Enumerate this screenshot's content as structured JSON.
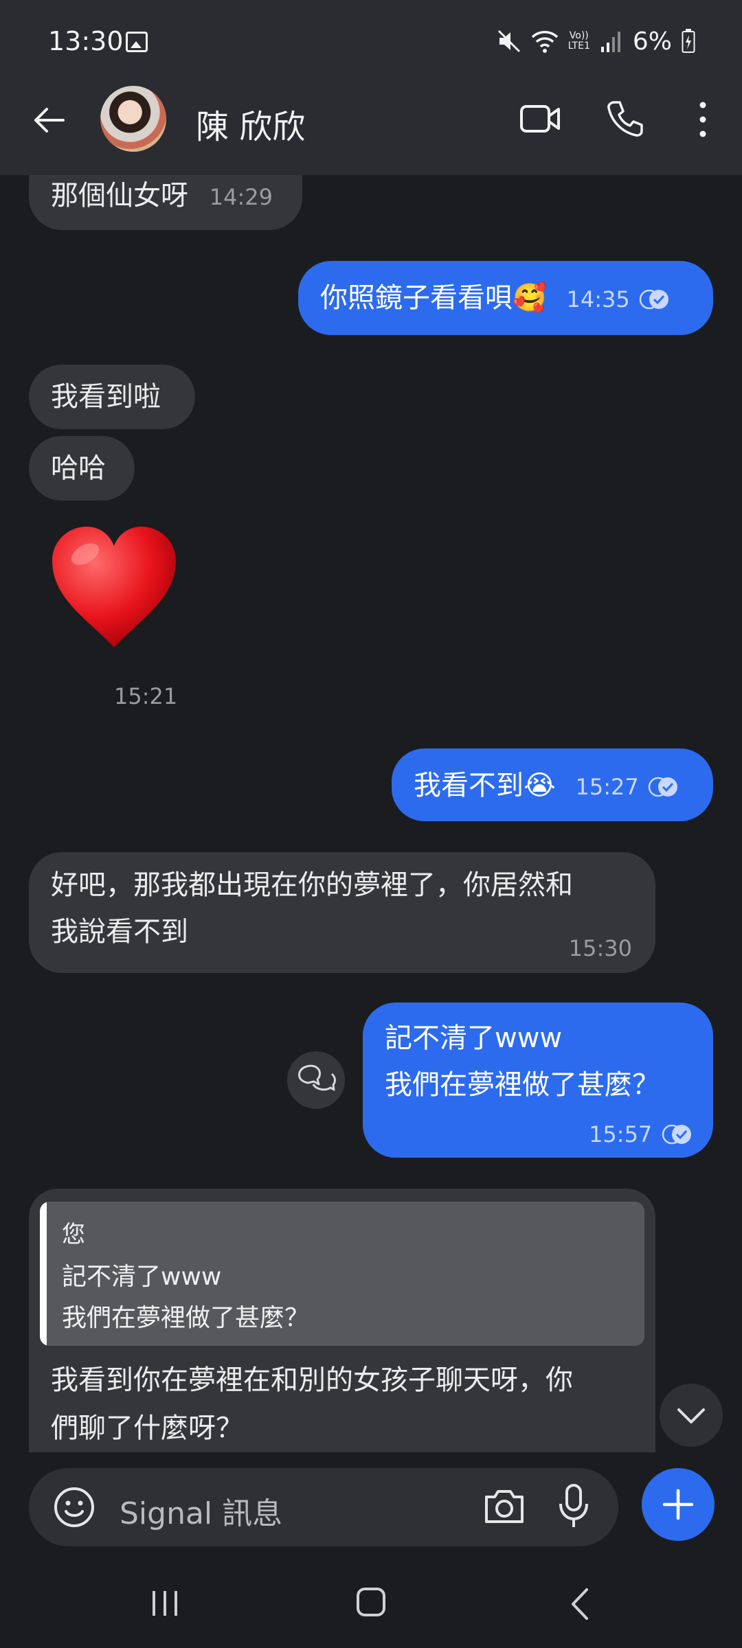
{
  "status_bar": {
    "time": "13:30",
    "lte_label_top": "Vo))",
    "lte_label_bottom": "LTE1",
    "battery": "6%"
  },
  "header": {
    "contact_name": "陳 欣欣"
  },
  "messages": [
    {
      "dir": "in",
      "text": "那個仙女呀",
      "time": "14:29"
    },
    {
      "dir": "out",
      "text": "你照鏡子看看唄🥰",
      "time": "14:35"
    },
    {
      "dir": "in",
      "text": "我看到啦"
    },
    {
      "dir": "in",
      "text": "哈哈"
    },
    {
      "dir": "in",
      "text": "❤",
      "time": "15:21",
      "kind": "big-emoji"
    },
    {
      "dir": "out",
      "text": "我看不到😭",
      "time": "15:27"
    },
    {
      "dir": "in",
      "line1": "好吧，那我都出現在你的夢裡了，你居然和",
      "line2": "我說看不到",
      "time": "15:30"
    },
    {
      "dir": "out",
      "line1": "記不清了www",
      "line2": "我們在夢裡做了甚麼？",
      "time": "15:57"
    },
    {
      "dir": "in",
      "quote": {
        "author": "您",
        "line1": "記不清了www",
        "line2": "我們在夢裡做了甚麼？"
      },
      "line1": "我看到你在夢裡在和別的女孩子聊天呀，你",
      "line2": "們聊了什麼呀？"
    }
  ],
  "composer": {
    "placeholder": "Signal 訊息"
  },
  "colors": {
    "outgoing_bubble": "#2c6bed",
    "incoming_bubble": "#35363a",
    "background": "#1b1c1f",
    "header": "#2a2c31"
  },
  "icons": [
    "image-icon",
    "mute-icon",
    "wifi-icon",
    "signal-icon",
    "battery-icon",
    "back-arrow-icon",
    "video-call-icon",
    "phone-icon",
    "more-icon",
    "delivered-check-icon",
    "reply-icon",
    "chevron-down-icon",
    "emoji-icon",
    "camera-icon",
    "mic-icon",
    "plus-icon",
    "recent-apps-icon",
    "home-icon",
    "nav-back-icon"
  ]
}
